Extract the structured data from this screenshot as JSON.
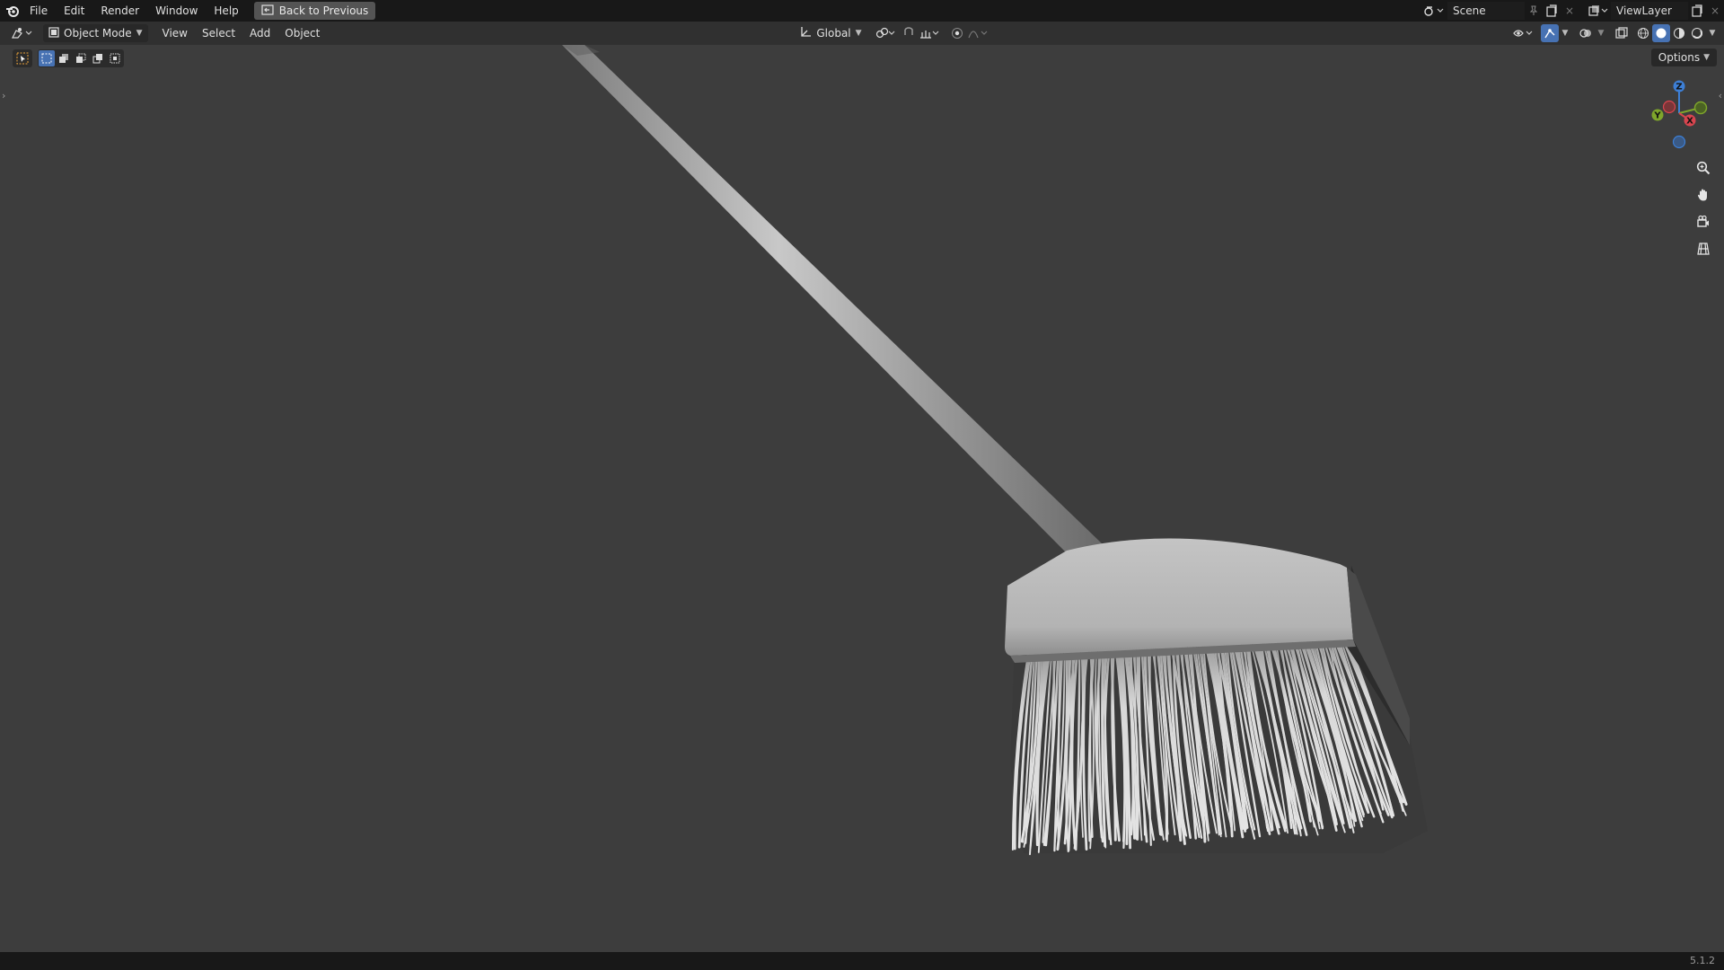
{
  "menu": {
    "items": [
      "File",
      "Edit",
      "Render",
      "Window",
      "Help"
    ],
    "back_label": "Back to Previous"
  },
  "scene": {
    "label": "Scene",
    "view_layer": "ViewLayer"
  },
  "header": {
    "mode": "Object Mode",
    "menus": [
      "View",
      "Select",
      "Add",
      "Object"
    ],
    "transform_orientation": "Global"
  },
  "viewport": {
    "options_label": "Options",
    "gizmo_axes": {
      "z": "Z",
      "y": "Y",
      "x": "X"
    }
  },
  "status": {
    "version": "5.1.2"
  },
  "colors": {
    "accent": "#4772b3",
    "axis_x": "#d9454f",
    "axis_y": "#7ea52b",
    "axis_z": "#3d7fd6",
    "viewport_bg": "#3d3d3d"
  },
  "icons": {
    "blender": "blender-logo-icon",
    "editor": "viewport-editor-icon",
    "mode": "object-mode-icon",
    "zoom": "zoom-icon",
    "pan": "hand-pan-icon",
    "camera": "camera-view-icon",
    "grid": "ortho-grid-icon"
  }
}
